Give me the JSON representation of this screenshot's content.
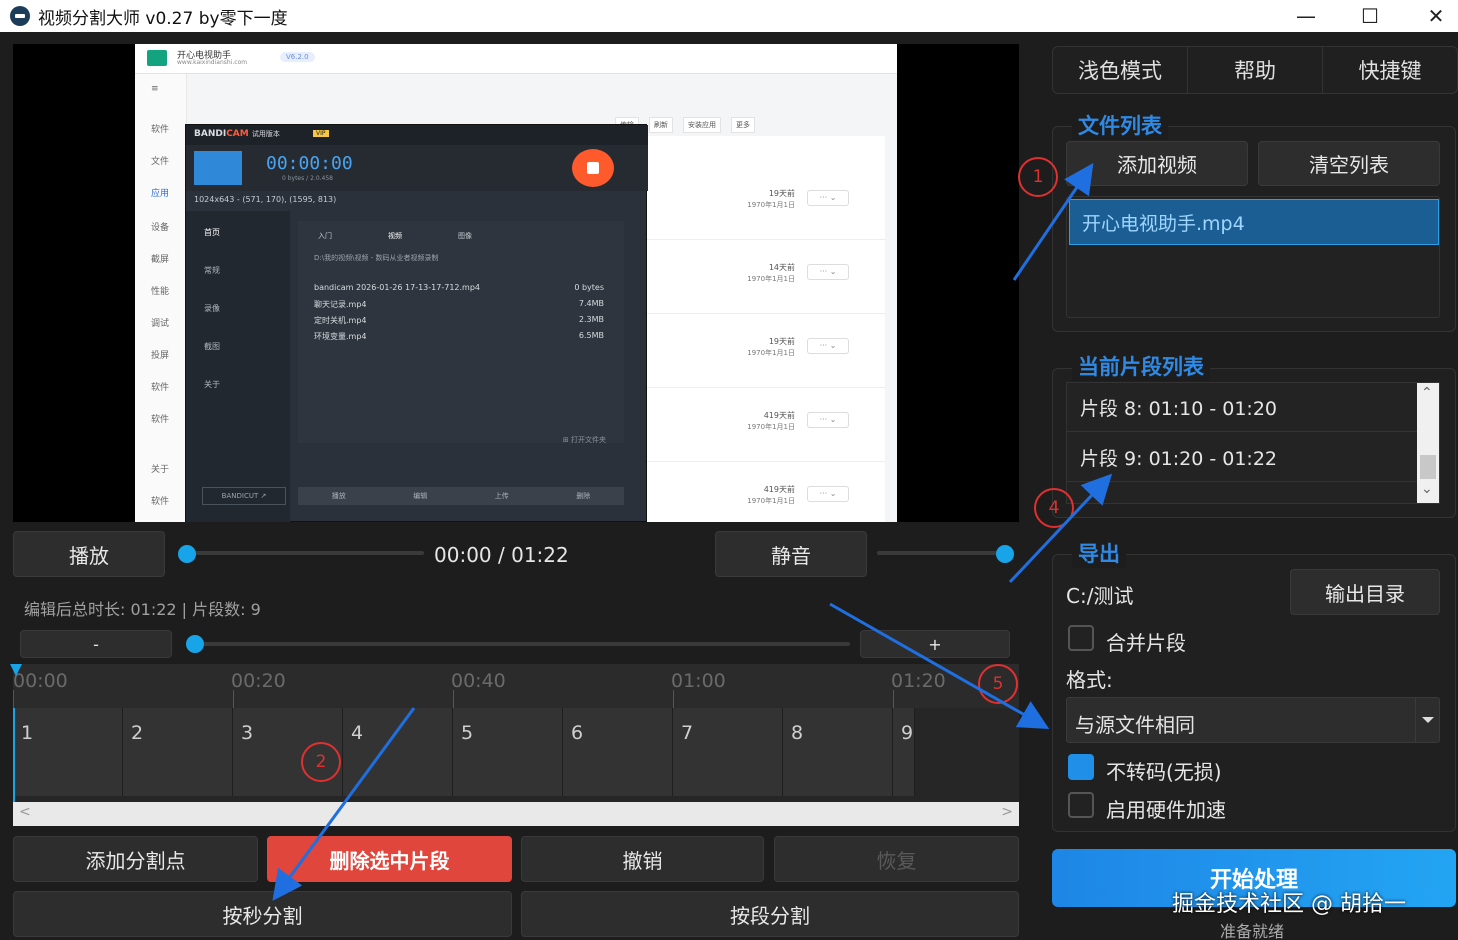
{
  "window": {
    "title": "视频分割大师 v0.27 by零下一度",
    "minimize": "—",
    "maximize": "☐",
    "close": "✕"
  },
  "video_frame": {
    "brand": "开心电视助手",
    "brand_sub": "www.kaixindianshi.com",
    "version": "V6.2.0",
    "sidebar": [
      "软件",
      "文件",
      "应用",
      "设备",
      "截屏",
      "性能",
      "调试",
      "投屏",
      "软件",
      "软件",
      "关于",
      "软件"
    ],
    "toolbar": [
      "传输",
      "刷新",
      "安装应用",
      "更多"
    ],
    "file_rows": [
      {
        "days": "19天前",
        "date": "1970年1月1日"
      },
      {
        "days": "14天前",
        "date": "1970年1月1日"
      },
      {
        "days": "19天前",
        "date": "1970年1月1日"
      },
      {
        "days": "419天前",
        "date": "1970年1月1日"
      },
      {
        "days": "419天前",
        "date": "1970年1月1日"
      }
    ],
    "more_label": "··· ⌄",
    "bandicam": {
      "name_pre": "BANDI",
      "name_post": "CAM",
      "trial": "试用版本",
      "vip": "VIP",
      "timer": "00:00:00",
      "timer_sub": "0 bytes / 2.0.458",
      "resolution": "1024x643 - (571, 170), (1595, 813)",
      "side": [
        "首页",
        "常规",
        "录像",
        "截图",
        "关于"
      ],
      "tabs": [
        "入门",
        "视频",
        "图像"
      ],
      "path": "D:\\我的视频\\视频 - 数码从业者视频录制",
      "files": [
        {
          "name": "bandicam 2026-01-26 17-13-17-712.mp4",
          "size": "0 bytes"
        },
        {
          "name": "聊天记录.mp4",
          "size": "7.4MB"
        },
        {
          "name": "定时关机.mp4",
          "size": "2.3MB"
        },
        {
          "name": "环境变量.mp4",
          "size": "6.5MB"
        }
      ],
      "footer": [
        "播放",
        "编辑",
        "上传",
        "删除"
      ],
      "bandicut": "BANDICUT ↗",
      "open_folder": "⊞ 打开文件夹"
    }
  },
  "playback": {
    "play_label": "播放",
    "time": "00:00 / 01:22",
    "mute_label": "静音",
    "progress": 0,
    "volume": 1
  },
  "info": {
    "summary": "编辑后总时长: 01:22 | 片段数: 9"
  },
  "zoom": {
    "minus_label": "-",
    "plus_label": "+",
    "level": 0
  },
  "timeline": {
    "ticks": [
      "00:00",
      "00:20",
      "00:40",
      "01:00",
      "01:20"
    ],
    "duration_sec": 82,
    "split_points_sec": [
      0,
      10,
      20,
      30,
      40,
      50,
      60,
      70,
      80,
      82
    ],
    "segments": [
      "1",
      "2",
      "3",
      "4",
      "5",
      "6",
      "7",
      "8",
      "9"
    ],
    "scroll_left": "<",
    "scroll_right": ">"
  },
  "actions": {
    "add_split": "添加分割点",
    "delete_segment": "删除选中片段",
    "undo": "撤销",
    "redo": "恢复",
    "split_by_seconds": "按秒分割",
    "split_by_segment": "按段分割"
  },
  "topbar": {
    "light_mode": "浅色模式",
    "help": "帮助",
    "shortcuts": "快捷键"
  },
  "file_list": {
    "title": "文件列表",
    "add_video": "添加视频",
    "clear_list": "清空列表",
    "files": [
      "开心电视助手.mp4"
    ]
  },
  "segment_list": {
    "title": "当前片段列表",
    "items": [
      "片段 8: 01:10 - 01:20",
      "片段 9: 01:20 - 01:22"
    ],
    "scroll_up": "⌃",
    "scroll_down": "⌄"
  },
  "export": {
    "title": "导出",
    "path": "C:/测试",
    "output_dir": "输出目录",
    "merge_label": "合并片段",
    "merge_checked": false,
    "format_label": "格式:",
    "format_value": "与源文件相同",
    "no_transcode_label": "不转码(无损)",
    "no_transcode_checked": true,
    "hw_accel_label": "启用硬件加速",
    "hw_accel_checked": false
  },
  "start": {
    "label": "开始处理",
    "status": "准备就绪",
    "watermark": "掘金技术社区 @ 胡拾一"
  },
  "annotations": [
    "1",
    "2",
    "4",
    "5"
  ],
  "colors": {
    "accent": "#1f8fe8",
    "title_blue": "#2f8ae6",
    "danger": "#e0463c",
    "annotation_red": "#e03030",
    "arrow_blue": "#1f6fe0"
  }
}
